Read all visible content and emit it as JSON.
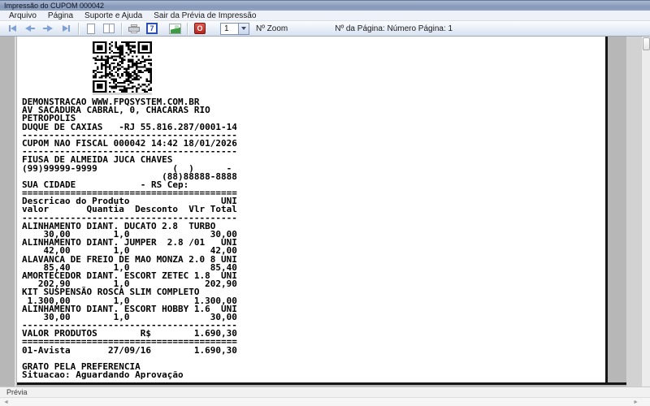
{
  "window": {
    "title": "Impressão do CUPOM 000042"
  },
  "menu": {
    "items": [
      {
        "label": "Arquivo"
      },
      {
        "label": "Página"
      },
      {
        "label": "Suporte e Ajuda"
      },
      {
        "label": "Sair da Prévia de Impressão"
      }
    ]
  },
  "toolbar": {
    "icons": [
      "first-page-icon",
      "previous-page-icon",
      "next-page-icon",
      "last-page-icon",
      "single-page-view-icon",
      "two-page-view-icon",
      "printer-icon",
      "print-setup-icon",
      "export-icon",
      "close-preview-icon",
      "qr-code"
    ],
    "zoom_value": "1",
    "zoom_label": "Nº Zoom",
    "page_label": "Nº da Página: Número Página: 1"
  },
  "statusbar": {
    "label": "Prévia"
  },
  "colors": {
    "titlebar": "#8699ba",
    "toolbar_bg": "#e2eaf5",
    "close_red": "#b6251d",
    "export_green": "#3f9b42",
    "icon_blue": "#2b50b5",
    "preview_gray": "#b7b7b7",
    "paper": "#ffffff"
  },
  "receipt": {
    "lines": [
      "DEMONSTRACAO WWW.FPQSYSTEM.COM.BR",
      "AV SACADURA CABRAL, 0, CHACARAS RIO",
      "PETROPOLIS",
      "DUQUE DE CAXIAS   -RJ 55.816.287/0001-14",
      "----------------------------------------",
      "CUPOM NAO FISCAL 000042 14:42 18/01/2026",
      "----------------------------------------",
      "FIUSA DE ALMEIDA JUCA CHAVES",
      "(99)99999-9999              (  )      -",
      "                          (88)88888-8888",
      "SUA CIDADE            - RS Cep:",
      "========================================",
      "Descricao do Produto                 UNI",
      "valor       Quantia  Desconto  Vlr Total",
      "----------------------------------------",
      "ALINHAMENTO DIANT. DUCATO 2.8  TURBO",
      "    30,00        1,0               30,00",
      "ALINHAMENTO DIANT. JUMPER  2.8 /01   UNI",
      "    42,00        1,0               42,00",
      "ALAVANCA DE FREIO DE MAO MONZA 2.0 8 UNI",
      "    85,40        1,0               85,40",
      "AMORTECEDOR DIANT. ESCORT ZETEC 1.8  UNI",
      "   202,90        1,0              202,90",
      "KIT SUSPENSÃO ROSCA SLIM COMPLETO",
      " 1.300,00        1,0            1.300,00",
      "ALINHAMENTO DIANT. ESCORT HOBBY 1.6  UNI",
      "    30,00        1,0               30,00",
      "----------------------------------------",
      "VALOR PRODUTOS        R$        1.690,30",
      "========================================",
      "01-Avista       27/09/16        1.690,30",
      "",
      "GRATO PELA PREFERENCIA",
      "Situacao: Aguardando Aprovação"
    ]
  }
}
